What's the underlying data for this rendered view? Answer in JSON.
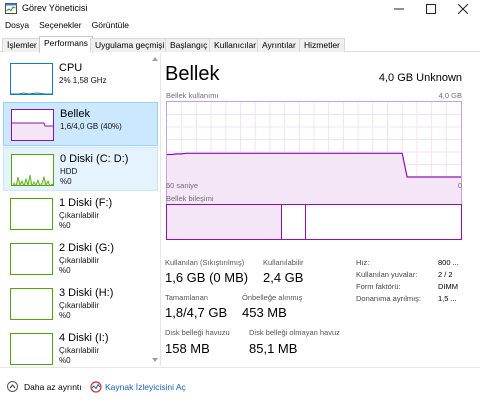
{
  "window": {
    "title": "Görev Yöneticisi"
  },
  "menu": [
    "Dosya",
    "Seçenekler",
    "Görüntüle"
  ],
  "tabs": [
    "İşlemler",
    "Performans",
    "Uygulama geçmişi",
    "Başlangıç",
    "Kullanıcılar",
    "Ayrıntılar",
    "Hizmetler"
  ],
  "active_tab": "Performans",
  "sidebar": {
    "items": [
      {
        "title": "CPU",
        "line1": "2%  1,58 GHz",
        "line2": ""
      },
      {
        "title": "Bellek",
        "line1": "1,6/4,0 GB (40%)",
        "line2": ""
      },
      {
        "title": "0 Diski (C: D:)",
        "line1": "HDD",
        "line2": "%0"
      },
      {
        "title": "1 Diski (F:)",
        "line1": "Çıkarılabilir",
        "line2": "%0"
      },
      {
        "title": "2 Diski (G:)",
        "line1": "Çıkarılabilir",
        "line2": "%0"
      },
      {
        "title": "3 Diski (H:)",
        "line1": "Çıkarılabilir",
        "line2": "%0"
      },
      {
        "title": "4 Diski (I:)",
        "line1": "Çıkarılabilir",
        "line2": "%0"
      }
    ]
  },
  "main": {
    "title": "Bellek",
    "spec": "4,0 GB Unknown",
    "usage_label": "Bellek kullanımı",
    "usage_max": "4,0 GB",
    "time_label": "60 saniye",
    "time_zero": "0",
    "composition_label": "Bellek bileşimi",
    "usage_fraction_history": [
      0.58,
      0.58,
      0.585,
      0.585,
      0.59,
      0.59,
      0.59,
      0.59,
      0.59,
      0.59,
      0.59,
      0.59,
      0.59,
      0.59,
      0.59,
      0.59,
      0.59,
      0.59,
      0.59,
      0.59,
      0.59,
      0.59,
      0.59,
      0.59,
      0.59,
      0.59,
      0.59,
      0.59,
      0.59,
      0.59,
      0.59,
      0.59,
      0.59,
      0.59,
      0.59,
      0.59,
      0.59,
      0.59,
      0.59,
      0.59,
      0.59,
      0.59,
      0.59,
      0.59,
      0.59,
      0.59,
      0.59,
      0.59,
      0.59,
      0.4,
      0.4,
      0.4,
      0.4,
      0.4,
      0.4,
      0.4,
      0.4,
      0.4,
      0.4,
      0.4,
      0.4
    ],
    "stats": {
      "in_use_label": "Kullanılan (Sıkıştırılmış)",
      "in_use_value": "1,6 GB (0 MB)",
      "available_label": "Kullanılabilir",
      "available_value": "2,4 GB",
      "committed_label": "Tamamlanan",
      "committed_value": "1,8/4,7 GB",
      "cached_label": "Önbelleğe alınmış",
      "cached_value": "453 MB",
      "paged_label": "Disk belleği havuzu",
      "paged_value": "158 MB",
      "nonpaged_label": "Disk belleği olmayan havuz",
      "nonpaged_value": "85,1 MB"
    },
    "details": [
      {
        "label": "Hız:",
        "value": "800 ..."
      },
      {
        "label": "Kullanılan yuvalar:",
        "value": "2 / 2"
      },
      {
        "label": "Form faktörü:",
        "value": "DIMM"
      },
      {
        "label": "Donanıma ayrılmış:",
        "value": "1,5 ..."
      }
    ]
  },
  "footer": {
    "less_details": "Daha az ayrıntı",
    "resource_monitor": "Kaynak İzleyicisini Aç"
  },
  "colors": {
    "memory": "#8b12ae",
    "cpu": "#117dbb",
    "disk": "#4da60c",
    "selected": "#cce8ff"
  }
}
